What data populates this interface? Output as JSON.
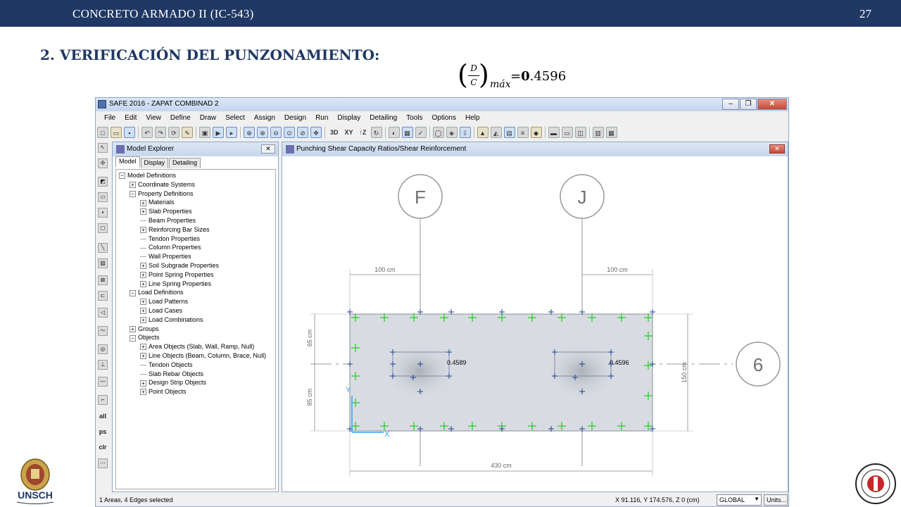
{
  "slide": {
    "course": "CONCRETO ARMADO II (IC-543)",
    "page": "27",
    "title": "2. VERIFICACIÓN DEL PUNZONAMIENTO:",
    "formula": {
      "numerator": "D",
      "denominator": "C",
      "subscript": "máx",
      "equals": "=",
      "value_int": "0",
      "value_dec": ".4596"
    },
    "logo_left_text": "UNSCH"
  },
  "app": {
    "title": "SAFE 2016 - ZAPAT COMBINAD 2",
    "menu": [
      "File",
      "Edit",
      "View",
      "Define",
      "Draw",
      "Select",
      "Assign",
      "Design",
      "Run",
      "Display",
      "Detailing",
      "Tools",
      "Options",
      "Help"
    ],
    "toolbar_text": [
      "3D",
      "XY",
      "↑Z"
    ],
    "left_tool_text": [
      "all",
      "ps",
      "clr"
    ]
  },
  "explorer": {
    "title": "Model Explorer",
    "tabs": [
      "Model",
      "Display",
      "Detailing"
    ],
    "tree": [
      {
        "label": "Model Definitions",
        "indent": 0,
        "exp": "-"
      },
      {
        "label": "Coordinate Systems",
        "indent": 1,
        "exp": "+"
      },
      {
        "label": "Property Definitions",
        "indent": 1,
        "exp": "-"
      },
      {
        "label": "Materials",
        "indent": 2,
        "exp": "+"
      },
      {
        "label": "Slab Properties",
        "indent": 2,
        "exp": "+"
      },
      {
        "label": "Beam Properties",
        "indent": 2,
        "exp": ""
      },
      {
        "label": "Reinforcing Bar Sizes",
        "indent": 2,
        "exp": "+"
      },
      {
        "label": "Tendon Properties",
        "indent": 2,
        "exp": ""
      },
      {
        "label": "Column Properties",
        "indent": 2,
        "exp": ""
      },
      {
        "label": "Wall Properties",
        "indent": 2,
        "exp": ""
      },
      {
        "label": "Soil Subgrade Properties",
        "indent": 2,
        "exp": "+"
      },
      {
        "label": "Point Spring Properties",
        "indent": 2,
        "exp": "+"
      },
      {
        "label": "Line Spring Properties",
        "indent": 2,
        "exp": "+"
      },
      {
        "label": "Load Definitions",
        "indent": 1,
        "exp": "-"
      },
      {
        "label": "Load Patterns",
        "indent": 2,
        "exp": "+"
      },
      {
        "label": "Load Cases",
        "indent": 2,
        "exp": "+"
      },
      {
        "label": "Load Combinations",
        "indent": 2,
        "exp": "+"
      },
      {
        "label": "Groups",
        "indent": 1,
        "exp": "+"
      },
      {
        "label": "Objects",
        "indent": 1,
        "exp": "-"
      },
      {
        "label": "Area Objects (Slab, Wall, Ramp, Null)",
        "indent": 2,
        "exp": "+"
      },
      {
        "label": "Line Objects (Beam, Column, Brace, Null)",
        "indent": 2,
        "exp": "+"
      },
      {
        "label": "Tendon Objects",
        "indent": 2,
        "exp": ""
      },
      {
        "label": "Slab Rebar Objects",
        "indent": 2,
        "exp": ""
      },
      {
        "label": "Design Strip Objects",
        "indent": 2,
        "exp": "+"
      },
      {
        "label": "Point Objects",
        "indent": 2,
        "exp": "+"
      }
    ]
  },
  "punch": {
    "title": "Punching Shear Capacity Ratios/Shear Reinforcement",
    "grid_labels": [
      "F",
      "J",
      "6"
    ],
    "dims": {
      "top_left": "100 cm",
      "top_right": "100 cm",
      "left_top": "65 cm",
      "left_bottom": "85 cm",
      "right": "150 cm",
      "bottom": "430 cm"
    },
    "ratios": [
      "0.4589",
      "0.4596"
    ],
    "axis_labels": [
      "Y",
      "X"
    ],
    "colors": {
      "green_marks": "#22cc22",
      "blue_marks": "#1f3f8f",
      "footing_fill": "#d8dce2"
    }
  },
  "status": {
    "selection": "1 Areas, 4 Edges selected",
    "coords": "X 91.116,  Y 174.576,  Z 0  (cm)",
    "system": "GLOBAL",
    "units": "Units..."
  }
}
